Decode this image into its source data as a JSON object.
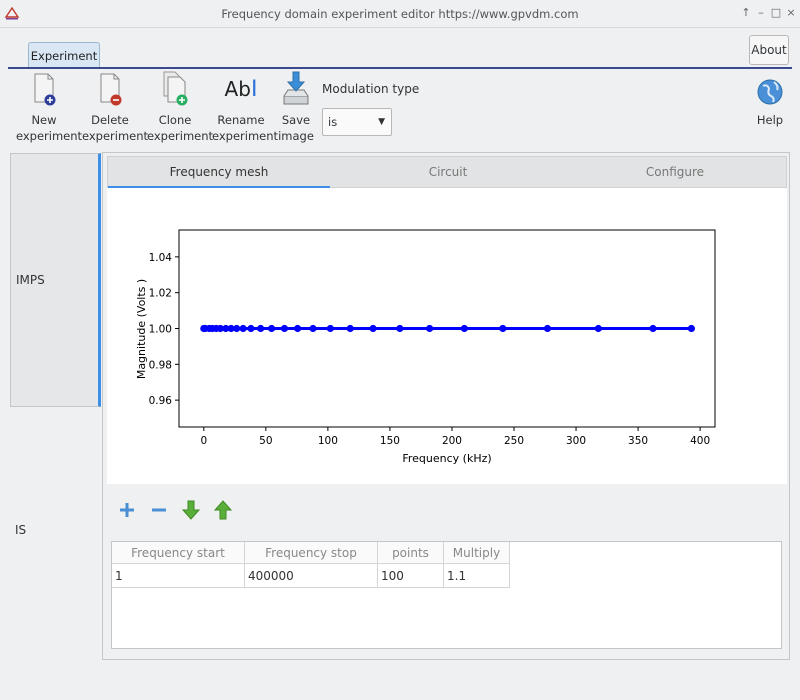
{
  "window": {
    "title": "Frequency domain experiment editor https://www.gpvdm.com",
    "controls": [
      "↑",
      "–",
      "□",
      "×"
    ]
  },
  "tabs": {
    "experiment": "Experiment",
    "about": "About"
  },
  "toolbar": {
    "new": [
      "New",
      "experiment"
    ],
    "delete": [
      "Delete",
      "experiment"
    ],
    "clone": [
      "Clone",
      "experiment"
    ],
    "rename": [
      "Rename",
      "experiment"
    ],
    "save": [
      "Save",
      "image"
    ],
    "rename_icon_text": "Ab",
    "modulation_label": "Modulation type",
    "modulation_value": "is",
    "help": "Help"
  },
  "left_tabs": {
    "imps": "IMPS",
    "is": "IS"
  },
  "inner_tabs": [
    "Frequency mesh",
    "Circuit",
    "Configure"
  ],
  "chart_data": {
    "type": "line",
    "xlabel": "Frequency (kHz)",
    "ylabel": "Magnitude (Volts )",
    "xlim": [
      -20,
      412
    ],
    "ylim": [
      0.945,
      1.055
    ],
    "xticks": [
      0,
      50,
      100,
      150,
      200,
      250,
      300,
      350,
      400
    ],
    "yticks": [
      0.96,
      0.98,
      1.0,
      1.02,
      1.04
    ],
    "ytick_labels": [
      "0.96",
      "0.98",
      "1.00",
      "1.02",
      "1.04"
    ],
    "series": [
      {
        "color": "#0000ff",
        "x": [
          0,
          1.1,
          4.4,
          6.8,
          10,
          13.3,
          17.7,
          22,
          26.5,
          31.7,
          38,
          45.8,
          54.6,
          65,
          75.6,
          88,
          102,
          118,
          136.4,
          158,
          182,
          210,
          241,
          277,
          318,
          362,
          393
        ],
        "y": [
          1.0,
          1.0,
          1.0,
          1.0,
          1.0,
          1.0,
          1.0,
          1.0,
          1.0,
          1.0,
          1.0,
          1.0,
          1.0,
          1.0,
          1.0,
          1.0,
          1.0,
          1.0,
          1.0,
          1.0,
          1.0,
          1.0,
          1.0,
          1.0,
          1.0,
          1.0,
          1.0
        ]
      }
    ]
  },
  "table": {
    "headers": [
      "Frequency start",
      "Frequency stop",
      "points",
      "Multiply"
    ],
    "rows": [
      [
        "1",
        "400000",
        "100",
        "1.1"
      ]
    ]
  },
  "colors": {
    "accent": "#3d8ee6",
    "tab_underline": "#3a4a8c",
    "series": "#0000ff"
  }
}
